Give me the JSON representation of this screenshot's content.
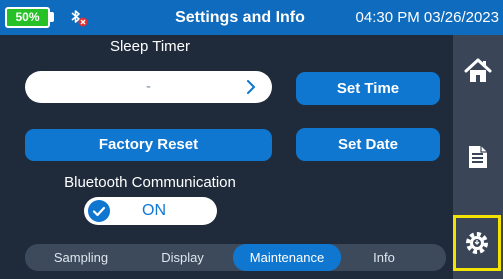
{
  "header": {
    "battery": "50%",
    "title": "Settings and Info",
    "clock": "04:30 PM 03/26/2023"
  },
  "main": {
    "sleep_timer_label": "Sleep Timer",
    "sleep_timer_value": "-",
    "set_time_label": "Set Time",
    "factory_reset_label": "Factory Reset",
    "set_date_label": "Set Date",
    "bluetooth_label": "Bluetooth Communication",
    "bluetooth_state": "ON"
  },
  "tabs": [
    {
      "label": "Sampling",
      "active": false
    },
    {
      "label": "Display",
      "active": false
    },
    {
      "label": "Maintenance",
      "active": true
    },
    {
      "label": "Info",
      "active": false
    }
  ],
  "side_nav": {
    "items": [
      "home-icon",
      "document-icon",
      "settings-icon"
    ],
    "active": "settings-icon"
  },
  "colors": {
    "header": "#0f6bbd",
    "background": "#1f2b3b",
    "accent": "#1077d1",
    "battery": "#26c126",
    "highlight": "#f2e300"
  }
}
